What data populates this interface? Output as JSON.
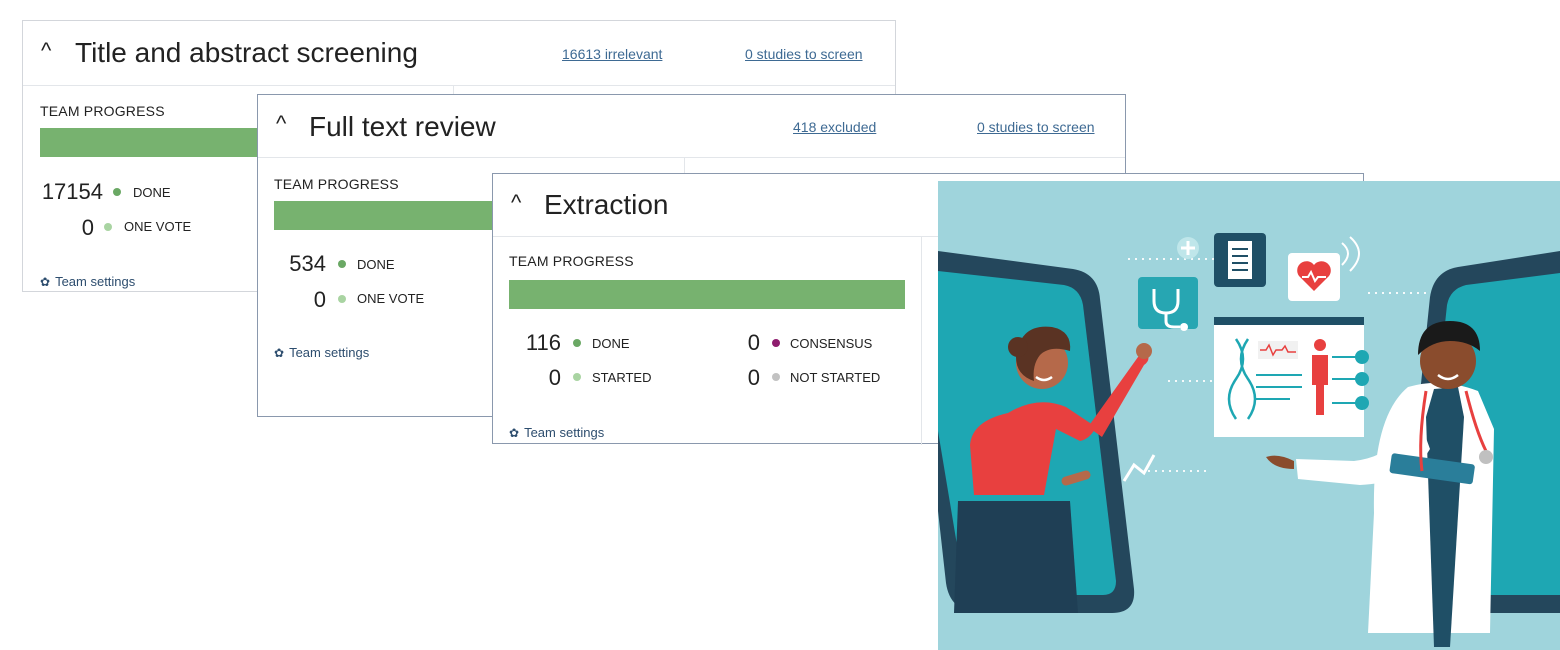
{
  "cards": [
    {
      "title": "Title and abstract screening",
      "link_a": "16613 irrelevant",
      "link_b": "0 studies to screen",
      "progress_label": "TEAM PROGRESS",
      "progress_fraction": 1.0,
      "stats": [
        {
          "value": "17154",
          "label": "DONE"
        },
        {
          "value": "0",
          "label": "ONE VOTE"
        }
      ],
      "settings_label": "Team settings"
    },
    {
      "title": "Full text review",
      "link_a": "418 excluded",
      "link_b": "0 studies to screen",
      "progress_label": "TEAM PROGRESS",
      "progress_fraction": 1.0,
      "stats": [
        {
          "value": "534",
          "label": "DONE"
        },
        {
          "value": "0",
          "label": "ONE VOTE"
        }
      ],
      "settings_label": "Team settings"
    },
    {
      "title": "Extraction",
      "progress_label": "TEAM PROGRESS",
      "progress_fraction": 1.0,
      "stats": [
        {
          "value": "116",
          "label": "DONE"
        },
        {
          "value": "0",
          "label": "STARTED"
        },
        {
          "value": "0",
          "label": "CONSENSUS"
        },
        {
          "value": "0",
          "label": "NOT STARTED"
        }
      ],
      "settings_label": "Team settings"
    }
  ],
  "icons": {
    "collapse": "chevron-up-icon",
    "settings": "gear-icon"
  },
  "colors": {
    "done": "#6aa864",
    "light_green": "#a9d4a2",
    "consensus": "#8e1c6e",
    "not_started": "#c2c2c2",
    "progress": "#77b26f",
    "link": "#3e6a93",
    "illustration_bg": "#9fd4dc"
  }
}
